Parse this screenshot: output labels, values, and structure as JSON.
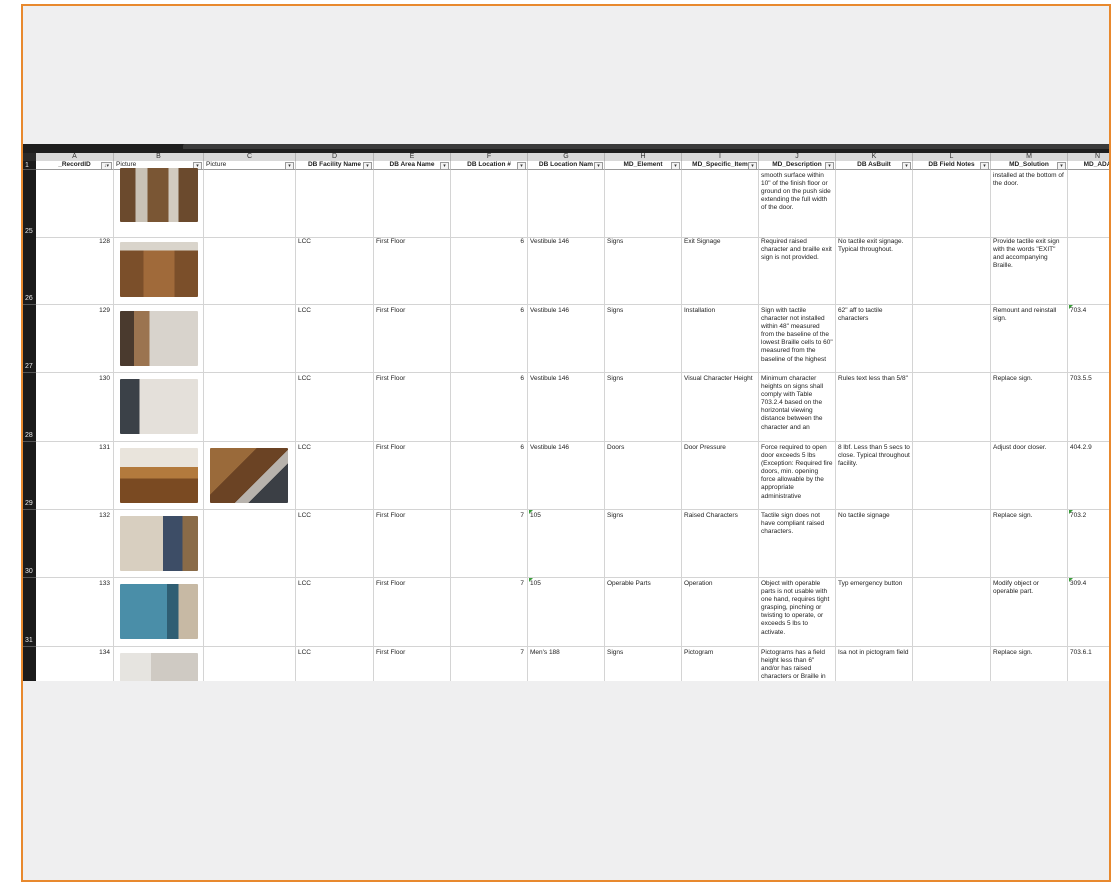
{
  "columns": [
    {
      "letter": "A",
      "header": "_RecordID"
    },
    {
      "letter": "B",
      "header": "Picture"
    },
    {
      "letter": "C",
      "header": "Picture"
    },
    {
      "letter": "D",
      "header": "DB Facility Name"
    },
    {
      "letter": "E",
      "header": "DB Area Name"
    },
    {
      "letter": "F",
      "header": "DB Location #"
    },
    {
      "letter": "G",
      "header": "DB Location Nam"
    },
    {
      "letter": "H",
      "header": "MD_Element"
    },
    {
      "letter": "I",
      "header": "MD_Specific_Item"
    },
    {
      "letter": "J",
      "header": "MD_Description"
    },
    {
      "letter": "K",
      "header": "DB AsBuilt"
    },
    {
      "letter": "L",
      "header": "DB Field Notes"
    },
    {
      "letter": "M",
      "header": "MD_Solution"
    },
    {
      "letter": "N",
      "header": "MD_ADA"
    }
  ],
  "header_row_number": "1",
  "rows": [
    {
      "num": "25",
      "record": "",
      "facility": "",
      "area": "",
      "locnum": "",
      "locname": "",
      "element": "",
      "item": "",
      "desc": "smooth surface within 10\" of the finish floor or ground on the push side extending the full width of the door.",
      "asbuilt": "",
      "notes": "",
      "solution": "installed at the bottom of the door.",
      "ada": ""
    },
    {
      "num": "26",
      "record": "128",
      "facility": "LCC",
      "area": "First Floor",
      "locnum": "6",
      "locname": "Vestibule 146",
      "element": "Signs",
      "item": "Exit Signage",
      "desc": "Required raised character and braille exit sign is not provided.",
      "asbuilt": "No tactile exit signage. Typical throughout.",
      "notes": "",
      "solution": "Provide tactile exit sign with the words \"EXIT\" and accompanying Braille.",
      "ada": ""
    },
    {
      "num": "27",
      "record": "129",
      "facility": "LCC",
      "area": "First Floor",
      "locnum": "6",
      "locname": "Vestibule 146",
      "element": "Signs",
      "item": "Installation",
      "desc": "Sign with tactile character not installed within 48\" measured from the baseline of the lowest Braille cells to 60\" measured from the baseline of the highest",
      "asbuilt": "62\" aff to tactile characters",
      "notes": "",
      "solution": "Remount and reinstall sign.",
      "ada": "703.4"
    },
    {
      "num": "28",
      "record": "130",
      "facility": "LCC",
      "area": "First Floor",
      "locnum": "6",
      "locname": "Vestibule 146",
      "element": "Signs",
      "item": "Visual Character Height",
      "desc": "Minimum character heights on signs shall comply with Table 703.2.4 based on the horizontal viewing distance between the character and an",
      "asbuilt": "Rules text less than 5/8\"",
      "notes": "",
      "solution": "Replace sign.",
      "ada": "703.5.5"
    },
    {
      "num": "29",
      "record": "131",
      "facility": "LCC",
      "area": "First Floor",
      "locnum": "6",
      "locname": "Vestibule 146",
      "element": "Doors",
      "item": "Door Pressure",
      "desc": "Force required to open door exceeds 5 lbs (Exception: Required fire doors, min. opening force allowable by the appropriate administrative",
      "asbuilt": "8 lbf. Less than 5 secs to close. Typical throughout facility.",
      "notes": "",
      "solution": "Adjust door closer.",
      "ada": "404.2.9"
    },
    {
      "num": "30",
      "record": "132",
      "facility": "LCC",
      "area": "First Floor",
      "locnum": "7",
      "locname": "105",
      "element": "Signs",
      "item": "Raised Characters",
      "desc": "Tactile sign does not have compliant raised characters.",
      "asbuilt": "No tactile signage",
      "notes": "",
      "solution": "Replace sign.",
      "ada": "703.2"
    },
    {
      "num": "31",
      "record": "133",
      "facility": "LCC",
      "area": "First Floor",
      "locnum": "7",
      "locname": "105",
      "element": "Operable Parts",
      "item": "Operation",
      "desc": "Object with operable parts is not usable with one hand, requires tight grasping, pinching or twisting to operate, or exceeds 5 lbs to activate.",
      "asbuilt": "Typ emergency button",
      "notes": "",
      "solution": "Modify object or operable part.",
      "ada": "309.4"
    },
    {
      "num": "",
      "record": "134",
      "facility": "LCC",
      "area": "First Floor",
      "locnum": "7",
      "locname": "Men's 188",
      "element": "Signs",
      "item": "Pictogram",
      "desc": "Pictograms has a field height less than 6\" and/or has raised characters or Braille in",
      "asbuilt": "Isa not in pictogram field",
      "notes": "",
      "solution": "Replace sign.",
      "ada": "703.6.1"
    }
  ],
  "filter_glyph": "▾",
  "sort_glyph": "↓▾",
  "colors": {
    "frame_border": "#e8892e",
    "comment_marker": "#3a9c3a",
    "row_header_bg": "#1b1b1b"
  }
}
